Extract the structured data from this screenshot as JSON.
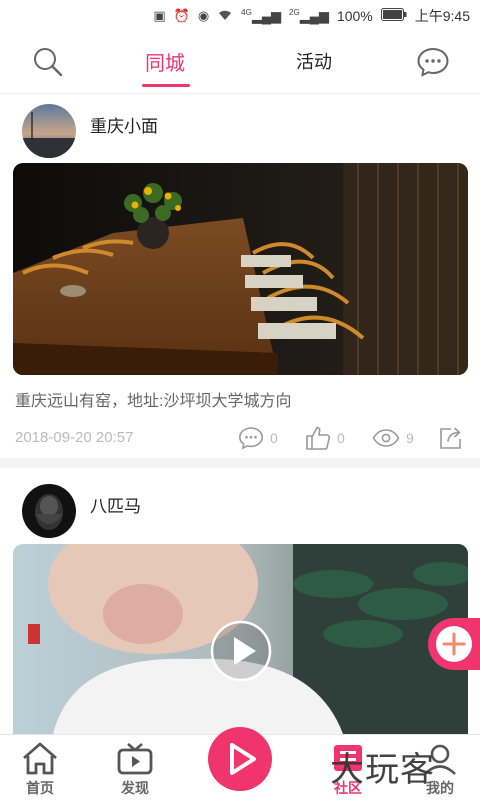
{
  "status_bar": {
    "battery": "100%",
    "signal_4g": "4G",
    "signal_2g": "2G",
    "time": "上午9:45"
  },
  "header": {
    "tabs": [
      {
        "label": "同城",
        "active": true
      },
      {
        "label": "活动",
        "active": false
      }
    ],
    "accent_color": "#f0356e"
  },
  "posts": [
    {
      "username": "重庆小面",
      "caption": "重庆远山有窑，地址:沙坪坝大学城方向",
      "timestamp": "2018-09-20 20:57",
      "comments": "0",
      "likes": "0",
      "views": "9"
    },
    {
      "username": "八匹马"
    }
  ],
  "bottom_nav": {
    "items": [
      {
        "label": "首页"
      },
      {
        "label": "发现"
      },
      {
        "label": "社区",
        "active": true
      },
      {
        "label": "我的"
      }
    ]
  },
  "watermark": "大玩客"
}
